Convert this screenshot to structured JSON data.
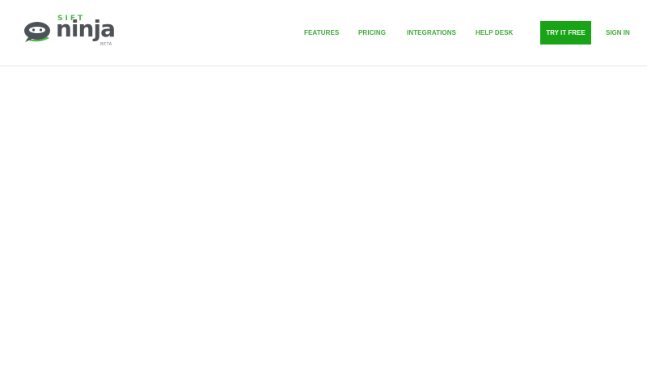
{
  "brand": {
    "name_top": "SIFT",
    "name_main": "ninja",
    "badge": "BETA",
    "icon": "ninja-chat-bubble-icon"
  },
  "nav": {
    "links": [
      {
        "label": "FEATURES"
      },
      {
        "label": "PRICING"
      },
      {
        "label": "INTEGRATIONS"
      },
      {
        "label": "HELP DESK"
      }
    ],
    "cta_label": "TRY IT FREE",
    "sign_in_label": "SIGN IN"
  },
  "colors": {
    "accent": "#19a317",
    "link": "#3fab37",
    "logo_dark": "#4d5258",
    "logo_green": "#4cb848"
  }
}
